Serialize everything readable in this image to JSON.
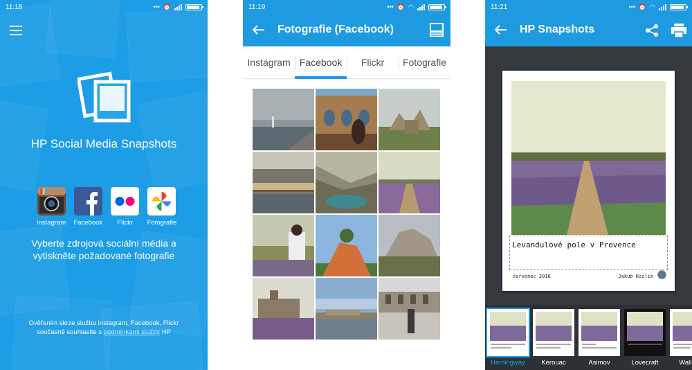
{
  "screen1": {
    "status": {
      "time": "11:18"
    },
    "app_title": "HP Social Media Snapshots",
    "sources": [
      {
        "label": "Instagram",
        "icon": "instagram-icon"
      },
      {
        "label": "Facebook",
        "icon": "facebook-icon"
      },
      {
        "label": "Flickr",
        "icon": "flickr-icon"
      },
      {
        "label": "Fotografie",
        "icon": "google-photos-icon"
      }
    ],
    "tagline": "Vyberte zdrojová sociální média a vytiskněte požadované fotografie",
    "consent": {
      "prefix": "Ověřením skrze službu Instagram, Facebook, Flickr současně souhlasíte s ",
      "link": "podmínkami služby",
      "suffix": " HP"
    }
  },
  "screen2": {
    "status": {
      "time": "11:19"
    },
    "title": "Fotografie (Facebook)",
    "tabs": [
      "Instagram",
      "Facebook",
      "Flickr",
      "Fotografie"
    ],
    "active_tab": "Facebook",
    "photo_count": 12
  },
  "screen3": {
    "status": {
      "time": "11:21"
    },
    "title": "HP Snapshots",
    "caption": "Levandulové pole v Provence",
    "date": "červenec 2016",
    "author": "Jakub Kozlík",
    "templates": [
      {
        "label": "Hemingway",
        "selected": true
      },
      {
        "label": "Kerouac",
        "selected": false
      },
      {
        "label": "Asimov",
        "selected": false
      },
      {
        "label": "Lovecraft",
        "selected": false
      },
      {
        "label": "Wallace",
        "selected": false
      }
    ]
  },
  "colors": {
    "accent": "#1e9be0",
    "screen1_bg": "#27a6ea",
    "preview_bg": "#353a3e"
  }
}
